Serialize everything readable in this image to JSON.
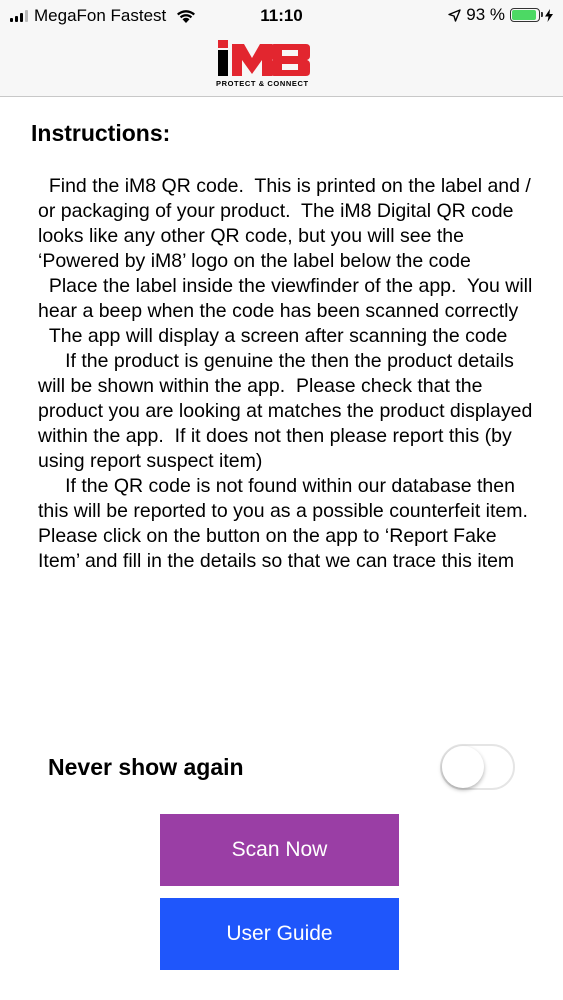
{
  "status_bar": {
    "carrier": "MegaFon Fastest",
    "time": "11:10",
    "battery_percent": "93 %",
    "battery_level": 0.93,
    "battery_color": "#4cd964"
  },
  "header": {
    "logo_text": "iM8",
    "logo_tagline": "PROTECT & CONNECT",
    "logo_color": "#e2262f"
  },
  "content": {
    "title": "Instructions:",
    "instructions": "  Find the iM8 QR code.  This is printed on the label and / or packaging of your product.  The iM8 Digital QR code looks like any other QR code, but you will see the ‘Powered by iM8’ logo on the label below the code\n  Place the label inside the viewfinder of the app.  You will hear a beep when the code has been scanned correctly\n  The app will display a screen after scanning the code\n     If the product is genuine the then the product details will be shown within the app.  Please check that the product you are looking at matches the product displayed within the app.  If it does not then please report this (by using report suspect item)\n     If the QR code is not found within our database then this will be reported to you as a possible counterfeit item.  Please click on the button on the app to ‘Report Fake Item’ and fill in the details so that we can trace this item"
  },
  "settings": {
    "never_show_label": "Never show again",
    "never_show_enabled": false
  },
  "buttons": {
    "scan_label": "Scan Now",
    "scan_color": "#9a3ea5",
    "guide_label": "User Guide",
    "guide_color": "#1f56fb"
  }
}
